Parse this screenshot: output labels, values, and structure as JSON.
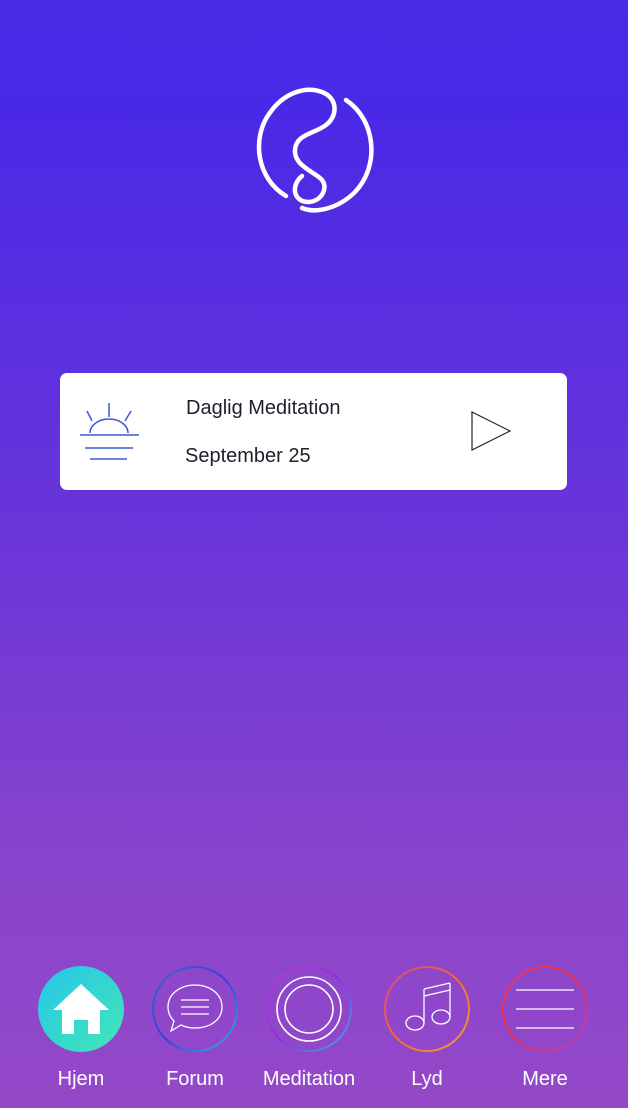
{
  "app": {
    "logo_icon": "s-logo-icon"
  },
  "daily_card": {
    "icon": "sunrise-icon",
    "title": "Daglig Meditation",
    "date": "September 25",
    "play_icon": "play-icon"
  },
  "tabbar": {
    "tabs": [
      {
        "label": "Hjem",
        "icon": "home-icon",
        "active": true
      },
      {
        "label": "Forum",
        "icon": "chat-bubble-icon",
        "active": false
      },
      {
        "label": "Meditation",
        "icon": "ring-icon",
        "active": false
      },
      {
        "label": "Lyd",
        "icon": "music-note-icon",
        "active": false
      },
      {
        "label": "Mere",
        "icon": "menu-icon",
        "active": false
      }
    ]
  },
  "colors": {
    "background_top": "#4b2be6",
    "background_bottom": "#9448c8",
    "card": "#ffffff",
    "accent_blue": "#3b58d8",
    "home_gradient_start": "#26c6e8",
    "home_gradient_end": "#43e6b7"
  }
}
